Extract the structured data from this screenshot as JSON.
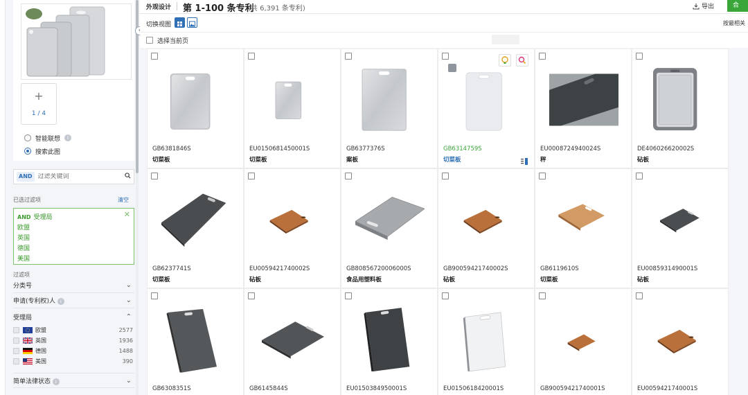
{
  "header": {
    "section": "外观设计",
    "title": "第 1-100 条专利",
    "total": "(共 6,391 条专利)",
    "export_label": "导出",
    "green_button_label": "合"
  },
  "viewbar": {
    "switch_label": "切换视图",
    "sort_label": "按最相关"
  },
  "select_page_label": "选择当前页",
  "sidebar": {
    "image_count": "1 / 4",
    "radio_smart": "智能联想",
    "radio_search_image": "搜索此图",
    "keyword_mode": "AND",
    "keyword_placeholder": "过滤关键词",
    "filtered_label": "已选过滤项",
    "clear_label": "清空",
    "active_filter": {
      "mode": "AND",
      "field": "受理局",
      "values": [
        "欧盟",
        "英国",
        "德国",
        "美国"
      ]
    },
    "filters_label": "过滤项",
    "facets": {
      "classification": "分类号",
      "applicant": "申请(专利权)人",
      "office": "受理局",
      "legal_status": "简单法律状态"
    },
    "office_counts": [
      {
        "name": "欧盟",
        "count": "2577",
        "flag": "eu"
      },
      {
        "name": "英国",
        "count": "1936",
        "flag": "uk"
      },
      {
        "name": "德国",
        "count": "1488",
        "flag": "de"
      },
      {
        "name": "美国",
        "count": "390",
        "flag": "us"
      }
    ]
  },
  "results": [
    {
      "id": "GB6381846S",
      "name": "切菜板",
      "pic": "steel"
    },
    {
      "id": "EU0150681450001S",
      "name": "切菜板",
      "pic": "steel-small"
    },
    {
      "id": "GB6377376S",
      "name": "案板",
      "pic": "steel-tall"
    },
    {
      "id": "GB6314759S",
      "name": "切菜板",
      "pic": "white-board",
      "highlight": true
    },
    {
      "id": "EU0008724940024S",
      "name": "秤",
      "pic": "photo-dark"
    },
    {
      "id": "DE406026620002S",
      "name": "砧板",
      "pic": "grey-grooved"
    },
    {
      "id": "GB6237741S",
      "name": "切菜板",
      "pic": "dark-persp"
    },
    {
      "id": "EU0059421740002S",
      "name": "砧板",
      "pic": "wood-small"
    },
    {
      "id": "GB80856720006000S",
      "name": "食品用塑料板",
      "pic": "grey-tray"
    },
    {
      "id": "GB90059421740002S",
      "name": "砧板",
      "pic": "wood-small"
    },
    {
      "id": "GB6119610S",
      "name": "切菜板",
      "pic": "wood-light"
    },
    {
      "id": "EU0085931490001S",
      "name": "砧板",
      "pic": "dark-small"
    },
    {
      "id": "GB6308351S",
      "name": "",
      "pic": "bamboo-dark"
    },
    {
      "id": "GB6145844S",
      "name": "",
      "pic": "dark-persp2"
    },
    {
      "id": "EU0150384950001S",
      "name": "",
      "pic": "bamboo-dark2"
    },
    {
      "id": "EU0150618420001S",
      "name": "",
      "pic": "white-persp"
    },
    {
      "id": "GB90059421740001S",
      "name": "",
      "pic": "wood-tiny"
    },
    {
      "id": "EU0059421740001S",
      "name": "",
      "pic": "wood-small"
    }
  ]
}
